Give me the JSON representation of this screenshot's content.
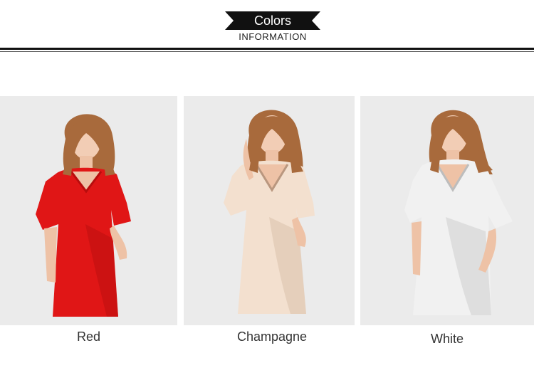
{
  "header": {
    "title": "Colors",
    "subtitle": "INFORMATION"
  },
  "products": [
    {
      "label": "Red",
      "color_name": "red",
      "dress_color": "#e01616",
      "dress_shade": "#b80d0d"
    },
    {
      "label": "Champagne",
      "color_name": "champagne",
      "dress_color": "#f3e0cf",
      "dress_shade": "#dcc3ae"
    },
    {
      "label": "White",
      "color_name": "white",
      "dress_color": "#f1f1f1",
      "dress_shade": "#d2d2d2"
    }
  ],
  "colors": {
    "banner": "#111111",
    "rule": "#111111",
    "card_bg": "#ebebeb",
    "hair": "#a86a3c",
    "skin": "#f2cdb5"
  }
}
